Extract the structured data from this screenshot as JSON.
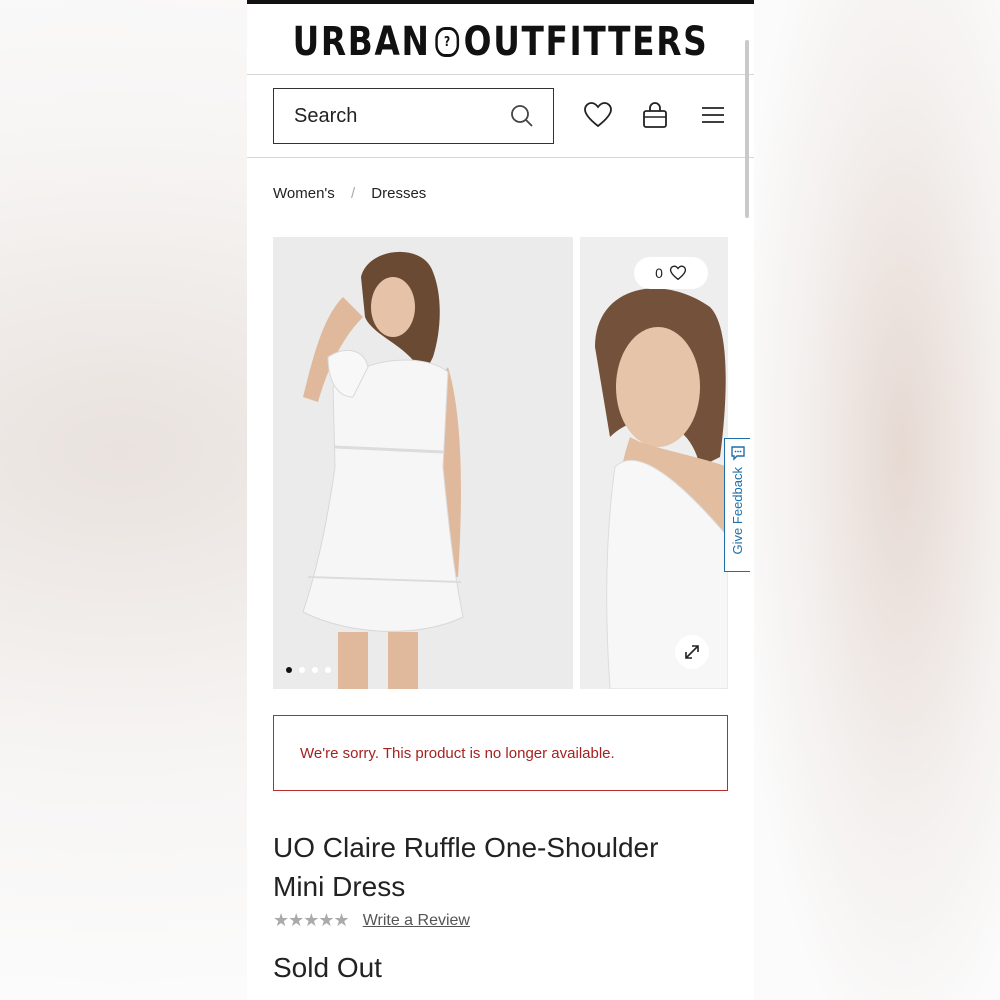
{
  "brand": {
    "logo_left": "URBAN",
    "logo_badge": "?",
    "logo_right": "OUTFITTERS"
  },
  "header": {
    "search_placeholder": "Search",
    "icons": [
      "search-icon",
      "heart-icon",
      "bag-icon",
      "menu-icon"
    ]
  },
  "breadcrumb": {
    "items": [
      "Women's",
      "Dresses"
    ],
    "separator": "/"
  },
  "gallery": {
    "favorite_count": "0",
    "dots_total": 4,
    "dots_active": 1
  },
  "feedback": {
    "label": "Give Feedback"
  },
  "alert": {
    "message": "We're sorry. This product is no longer available."
  },
  "product": {
    "title": "UO Claire Ruffle One-Shoulder Mini Dress",
    "stars": "★★★★★",
    "review_link": "Write a Review",
    "status": "Sold Out"
  },
  "colors": {
    "alert": "#b52d2d",
    "feedback": "#1f6fa8",
    "text": "#222222"
  }
}
